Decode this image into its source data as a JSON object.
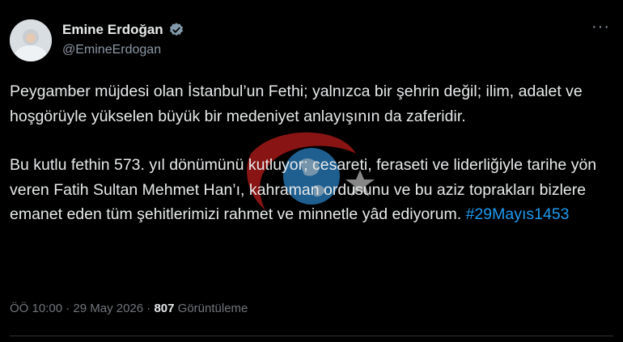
{
  "user": {
    "name": "Emine Erdoğan",
    "handle": "@EmineErdogan",
    "verified_icon": "verified-badge-icon"
  },
  "menu": {
    "more_label": "···"
  },
  "tweet": {
    "paragraph1": "Peygamber müjdesi olan İstanbul’un Fethi; yalnızca bir şehrin değil; ilim, adalet ve hoşgörüyle yükselen büyük bir medeniyet anlayışının da zaferidir.",
    "paragraph2": "Bu kutlu fethin 573. yıl dönümünü kutluyor; cesareti, feraseti ve liderliğiyle tarihe yön veren Fatih Sultan Mehmet Han’ı, kahraman ordusunu ve bu aziz toprakları bizlere emanet eden tüm şehitlerimizi rahmet ve minnetle yâd ediyorum.",
    "hashtag": "#29Mayıs1453"
  },
  "meta": {
    "time": "ÖÖ 10:00",
    "dot": "·",
    "date": "29 May 2026",
    "views_count": "807",
    "views_label": "Görüntüleme"
  },
  "colors": {
    "background": "#000000",
    "text": "#e7e9ea",
    "muted": "#71767b",
    "link": "#1d9bf0",
    "watermark_red": "#d6201f",
    "watermark_blue": "#2a7fc0"
  }
}
